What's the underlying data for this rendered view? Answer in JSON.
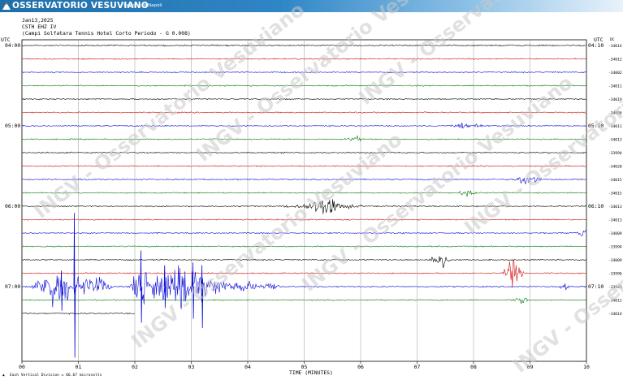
{
  "banner": {
    "title": "OSSERVATORIO VESUVIANO",
    "subtitle": "Sezione di Napoli",
    "icon": "volcano-logo-icon"
  },
  "header": {
    "date": "Jan13,2025",
    "station": "CSTH EHZ IV",
    "description": "(Campi Solfatara Tennis Hotel Corto Periodo - G 0.008)"
  },
  "corners": {
    "left_label": "UTC",
    "right_label": "UTC",
    "right_small": "DC"
  },
  "watermark": {
    "text": "INGV - Osservatorio Vesuviano"
  },
  "footer": {
    "scale_text": "Each Vertical Division =   66.67 microvolts",
    "scale_marker": "▲"
  },
  "colors": {
    "black": "#000000",
    "red": "#d01010",
    "blue": "#0b0bd6",
    "green": "#0a7a0a",
    "grid": "#999999",
    "watermark": "#c8c8c8"
  },
  "chart_data": {
    "type": "line",
    "title": "CSTH EHZ IV",
    "xlabel": "TIME (MINUTES)",
    "ylabel": "",
    "xlim": [
      0,
      10
    ],
    "x_ticks": [
      "00",
      "01",
      "02",
      "03",
      "04",
      "05",
      "06",
      "07",
      "08",
      "09",
      "10"
    ],
    "left_time_labels": [
      {
        "row": 0,
        "label": "04:00"
      },
      {
        "row": 6,
        "label": "05:00"
      },
      {
        "row": 12,
        "label": "06:00"
      },
      {
        "row": 18,
        "label": "07:00"
      }
    ],
    "right_time_labels": [
      {
        "row": 0,
        "label": "04:10"
      },
      {
        "row": 6,
        "label": "05:10"
      },
      {
        "row": 12,
        "label": "06:10"
      },
      {
        "row": 18,
        "label": "07:10"
      }
    ],
    "color_cycle": [
      "black",
      "red",
      "blue",
      "green"
    ],
    "traces": [
      {
        "dc": "-34014",
        "events": []
      },
      {
        "dc": "-34012",
        "events": []
      },
      {
        "dc": "-34002",
        "events": []
      },
      {
        "dc": "-34011",
        "events": []
      },
      {
        "dc": "-34019",
        "events": []
      },
      {
        "dc": "-34006",
        "events": []
      },
      {
        "dc": "-34011",
        "events": [
          {
            "t": 7.9,
            "amp": 0.6,
            "dur": 0.3
          }
        ]
      },
      {
        "dc": "-34013",
        "events": [
          {
            "t": 5.9,
            "amp": 0.4,
            "dur": 0.2
          }
        ]
      },
      {
        "dc": "-33994",
        "events": []
      },
      {
        "dc": "-34020",
        "events": []
      },
      {
        "dc": "-34015",
        "events": [
          {
            "t": 8.95,
            "amp": 0.9,
            "dur": 0.3
          }
        ]
      },
      {
        "dc": "-34015",
        "events": [
          {
            "t": 7.9,
            "amp": 0.5,
            "dur": 0.2
          }
        ]
      },
      {
        "dc": "-34013",
        "events": [
          {
            "t": 5.3,
            "amp": 0.6,
            "dur": 0.8
          },
          {
            "t": 5.4,
            "amp": 1.2,
            "dur": 0.3
          }
        ]
      },
      {
        "dc": "-34013",
        "events": []
      },
      {
        "dc": "-34009",
        "events": [
          {
            "t": 9.95,
            "amp": 0.6,
            "dur": 0.2
          }
        ]
      },
      {
        "dc": "-33994",
        "events": []
      },
      {
        "dc": "-34009",
        "events": [
          {
            "t": 7.4,
            "amp": 1.6,
            "dur": 0.2
          }
        ]
      },
      {
        "dc": "-33996",
        "events": [
          {
            "t": 8.7,
            "amp": 3.0,
            "dur": 0.2
          }
        ]
      },
      {
        "dc": "-33545",
        "events": [
          {
            "t": 0.55,
            "amp": 3.0,
            "dur": 0.4
          },
          {
            "t": 0.95,
            "amp": 1.5,
            "dur": 0.6
          },
          {
            "t": 1.35,
            "amp": 1.2,
            "dur": 0.3
          },
          {
            "t": 2.1,
            "amp": 4.5,
            "dur": 0.2
          },
          {
            "t": 2.45,
            "amp": 3.5,
            "dur": 0.3
          },
          {
            "t": 2.75,
            "amp": 3.8,
            "dur": 0.25
          },
          {
            "t": 3.05,
            "amp": 4.0,
            "dur": 0.3
          },
          {
            "t": 3.45,
            "amp": 1.5,
            "dur": 0.3
          },
          {
            "t": 3.95,
            "amp": 1.0,
            "dur": 0.3
          },
          {
            "t": 4.4,
            "amp": 0.8,
            "dur": 0.2
          },
          {
            "t": 9.6,
            "amp": 0.6,
            "dur": 0.1
          }
        ]
      },
      {
        "dc": "-34012",
        "events": [
          {
            "t": 8.85,
            "amp": 0.5,
            "dur": 0.2
          }
        ]
      },
      {
        "dc": "-34014",
        "events": [],
        "end_x": 2.0
      }
    ],
    "spikes": [
      {
        "row": 18,
        "t": 0.92,
        "up": 5.5,
        "down": 5.3
      },
      {
        "row": 18,
        "t": 0.69,
        "up": 1.2,
        "down": 1.8
      },
      {
        "row": 18,
        "t": 2.1,
        "up": 2.7,
        "down": 2.7
      },
      {
        "row": 18,
        "t": 2.52,
        "up": 1.6,
        "down": 1.6
      },
      {
        "row": 18,
        "t": 3.02,
        "up": 1.8,
        "down": 2.4
      },
      {
        "row": 18,
        "t": 3.18,
        "up": 1.6,
        "down": 3.1
      }
    ]
  }
}
